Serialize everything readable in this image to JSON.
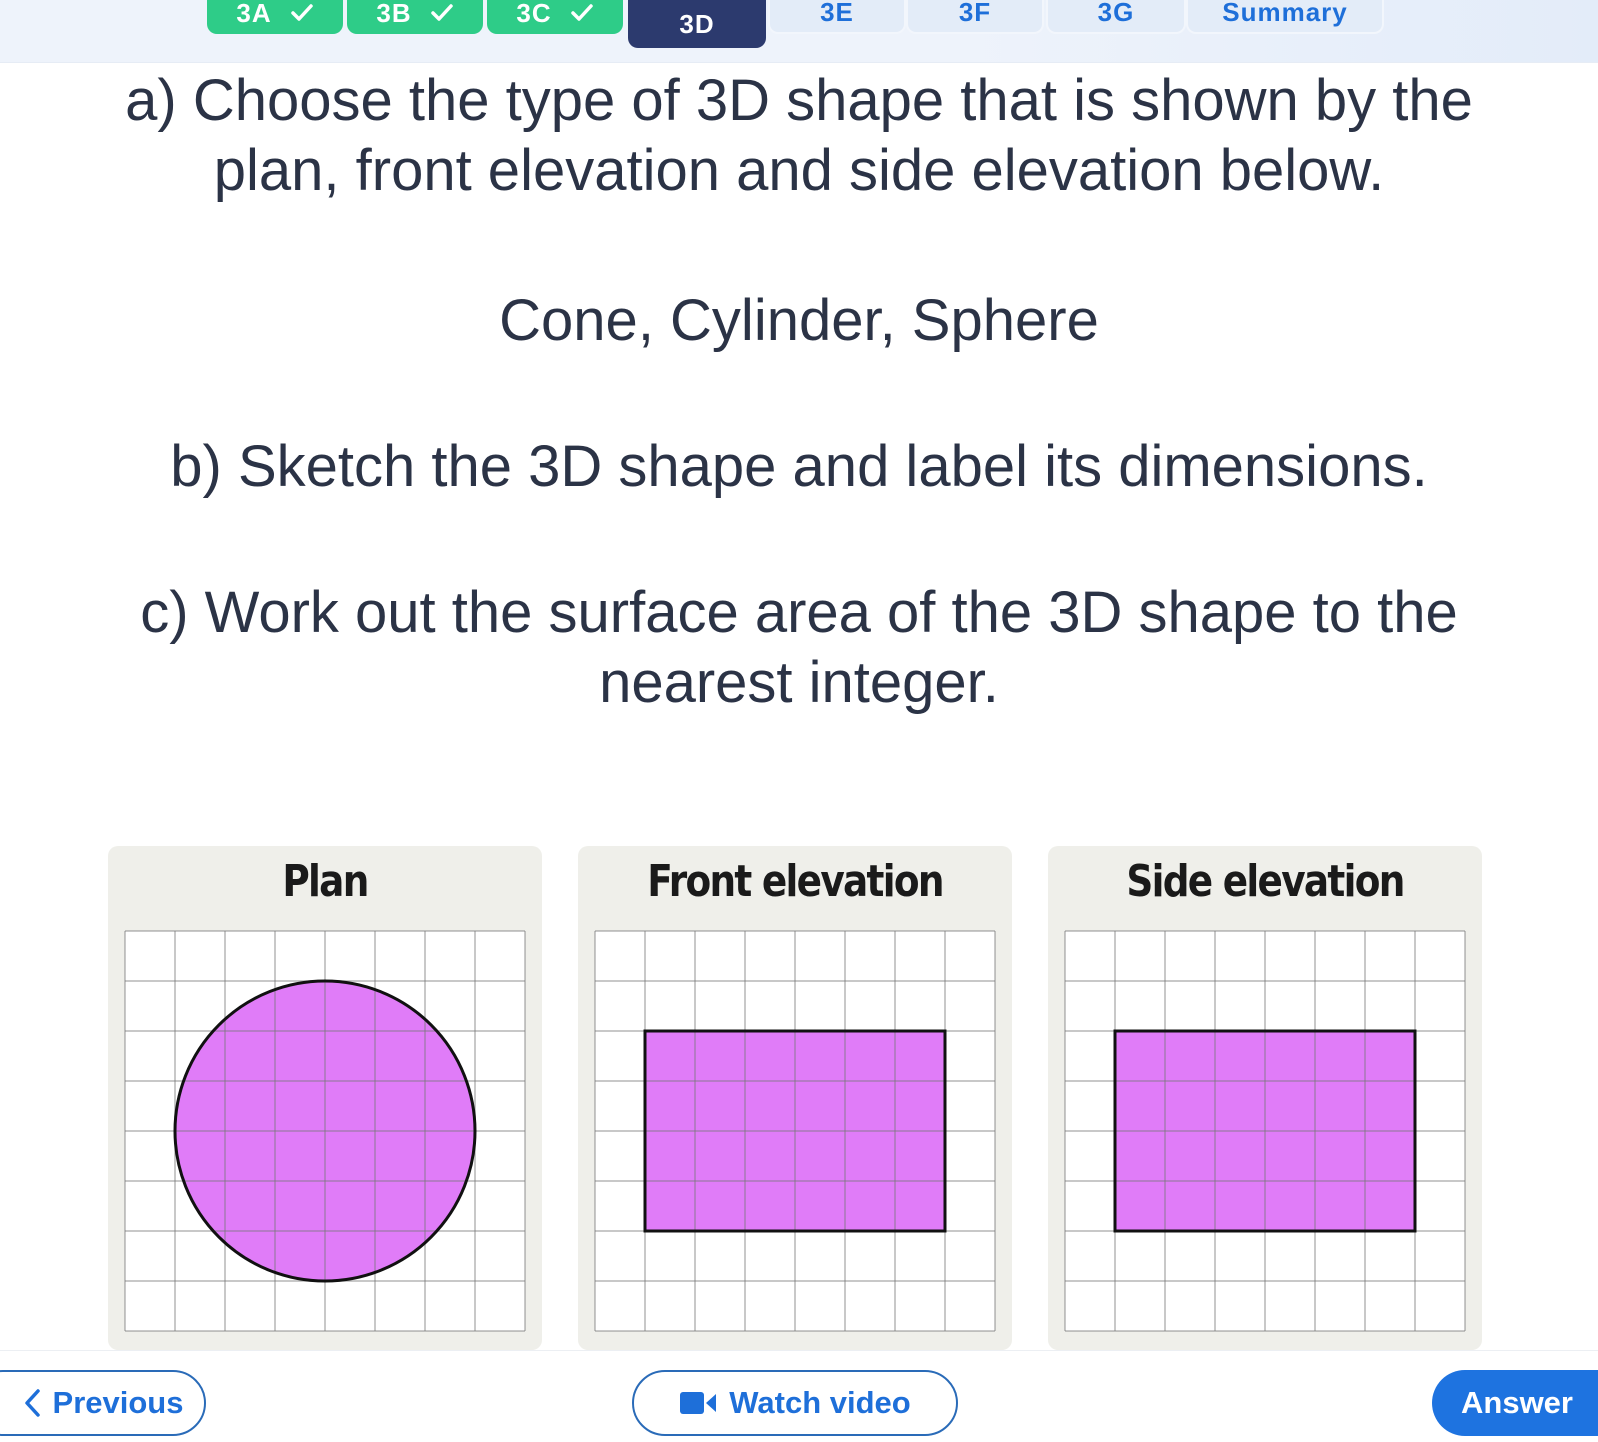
{
  "nav": {
    "tabs": [
      {
        "label": "3A",
        "state": "done",
        "icon": "check-icon"
      },
      {
        "label": "3B",
        "state": "done",
        "icon": "check-icon"
      },
      {
        "label": "3C",
        "state": "done",
        "icon": "check-icon"
      },
      {
        "label": "3D",
        "state": "current"
      },
      {
        "label": "3E",
        "state": "todo"
      },
      {
        "label": "3F",
        "state": "todo"
      },
      {
        "label": "3G",
        "state": "todo"
      },
      {
        "label": "Summary",
        "state": "todo"
      }
    ]
  },
  "question": {
    "part_a_line1": "a) Choose the type of 3D shape that is shown by the",
    "part_a_line2": "plan, front elevation and side elevation below.",
    "options": "Cone, Cylinder, Sphere",
    "part_b": "b) Sketch the 3D shape and label its dimensions.",
    "part_c_line1": "c) Work out the surface area of the 3D shape to the",
    "part_c_line2": "nearest integer."
  },
  "diagrams": [
    {
      "title": "Plan",
      "grid_cells": [
        8,
        8
      ],
      "shape": "circle",
      "diameter_squares": 6,
      "fill": "#e07cf8"
    },
    {
      "title": "Front elevation",
      "grid_cells": [
        8,
        8
      ],
      "shape": "rectangle",
      "width_squares": 6,
      "height_squares": 4,
      "fill": "#e07cf8"
    },
    {
      "title": "Side elevation",
      "grid_cells": [
        8,
        8
      ],
      "shape": "rectangle",
      "width_squares": 6,
      "height_squares": 4,
      "fill": "#e07cf8"
    }
  ],
  "footer": {
    "previous_label": "Previous",
    "watch_video_label": "Watch video",
    "answer_label": "Answer"
  },
  "colors": {
    "done": "#2ecc88",
    "current": "#2c3a6e",
    "accent": "#1e73e0",
    "shape_fill": "#e07cf8"
  }
}
